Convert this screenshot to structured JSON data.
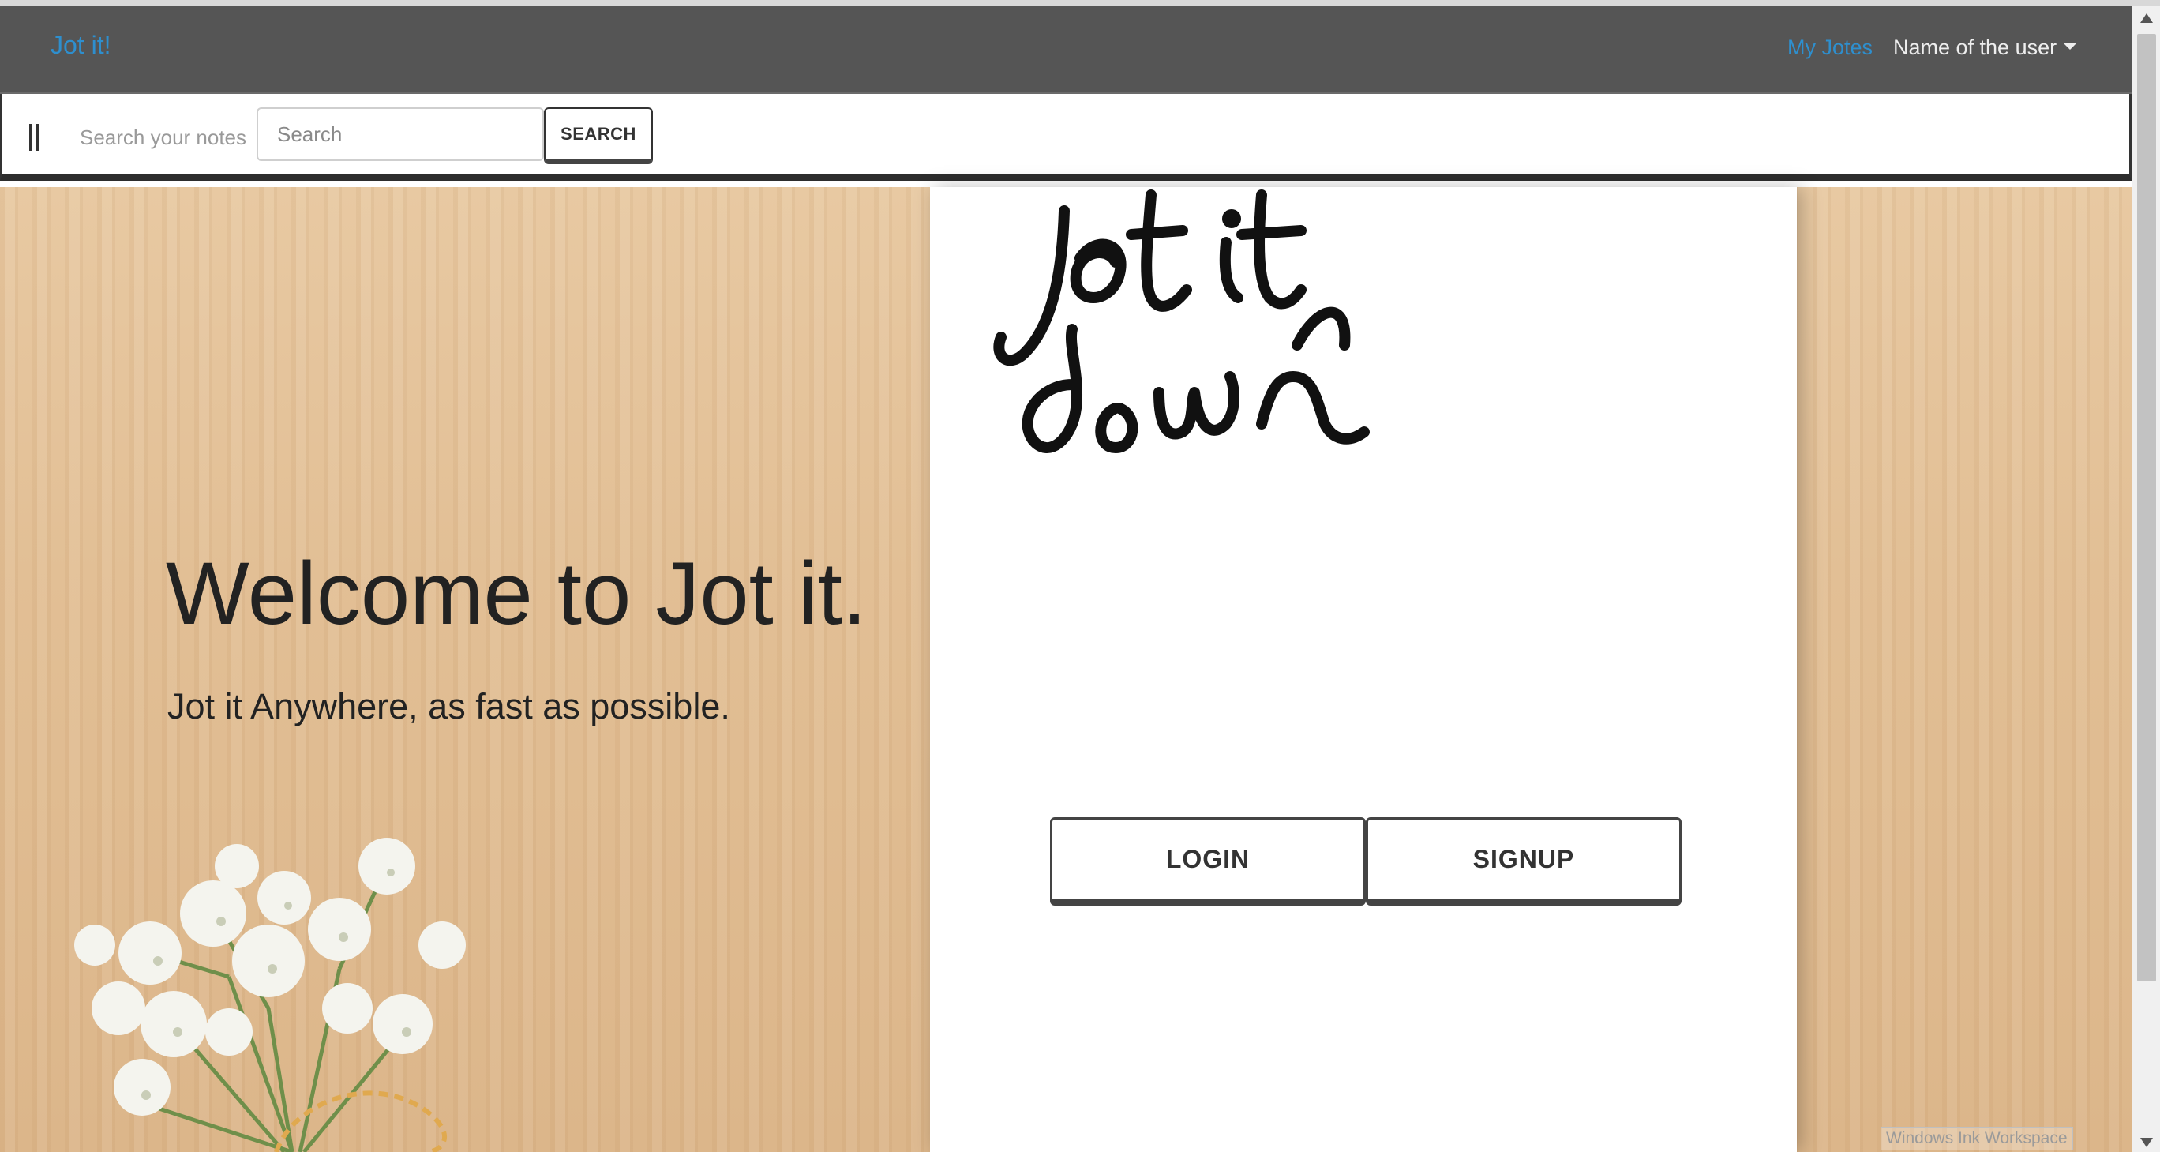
{
  "navbar": {
    "brand": "Jot it!",
    "links": [
      "My Jotes"
    ],
    "user_menu": "Name of the user"
  },
  "searchbar": {
    "label": "Search your notes",
    "placeholder": "Search",
    "button": "SEARCH"
  },
  "hero": {
    "title": "Welcome to Jot it.",
    "subtitle": "Jot it Anywhere, as fast as possible.",
    "logo_text": "jot it down",
    "buttons": {
      "login": "LOGIN",
      "signup": "SIGNUP"
    }
  },
  "system": {
    "tooltip": "Windows Ink Workspace"
  },
  "colors": {
    "navbar_bg": "#555555",
    "link": "#2e8fce",
    "wood": "#e2bf95"
  }
}
